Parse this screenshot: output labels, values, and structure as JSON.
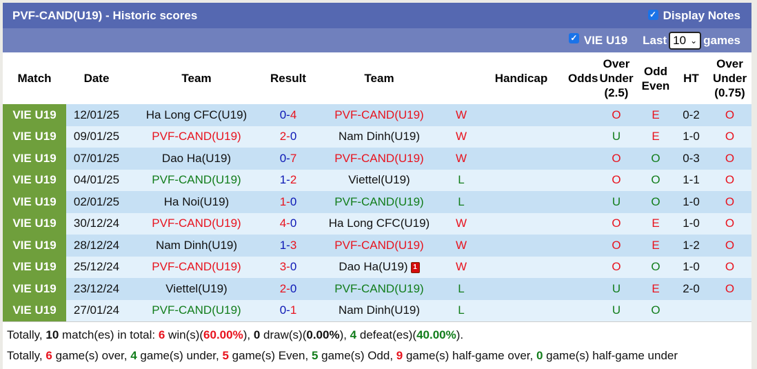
{
  "header": {
    "title": "PVF-CAND(U19) - Historic scores",
    "display_notes_label": "Display Notes",
    "display_notes_checked": true
  },
  "filters": {
    "league_label": "VIE U19",
    "league_checked": true,
    "last_label": "Last",
    "games_count": "10",
    "games_label": "games"
  },
  "columns": [
    "Match",
    "Date",
    "Team",
    "Result",
    "Team",
    "",
    "Handicap",
    "Odds",
    "Over Under (2.5)",
    "Odd Even",
    "HT",
    "Over Under (0.75)"
  ],
  "column_lines": {
    "ou25": [
      "Over",
      "Under",
      "(2.5)"
    ],
    "oddeven": [
      "Odd",
      "Even"
    ],
    "ou075": [
      "Over",
      "Under",
      "(0.75)"
    ]
  },
  "rows": [
    {
      "league": "VIE U19",
      "date": "12/01/25",
      "home": "Ha Long CFC(U19)",
      "home_color": "black",
      "score_home": "0",
      "score_away": "4",
      "away": "PVF-CAND(U19)",
      "away_color": "red",
      "outcome": "W",
      "handicap": "",
      "odds": "",
      "ou": "O",
      "oe": "E",
      "ht": "0-2",
      "ou075": "O"
    },
    {
      "league": "VIE U19",
      "date": "09/01/25",
      "home": "PVF-CAND(U19)",
      "home_color": "red",
      "score_home": "2",
      "score_away": "0",
      "away": "Nam Dinh(U19)",
      "away_color": "black",
      "outcome": "W",
      "handicap": "",
      "odds": "",
      "ou": "U",
      "oe": "E",
      "ht": "1-0",
      "ou075": "O"
    },
    {
      "league": "VIE U19",
      "date": "07/01/25",
      "home": "Dao Ha(U19)",
      "home_color": "black",
      "score_home": "0",
      "score_away": "7",
      "away": "PVF-CAND(U19)",
      "away_color": "red",
      "outcome": "W",
      "handicap": "",
      "odds": "",
      "ou": "O",
      "oe": "O",
      "ht": "0-3",
      "ou075": "O"
    },
    {
      "league": "VIE U19",
      "date": "04/01/25",
      "home": "PVF-CAND(U19)",
      "home_color": "green",
      "score_home": "1",
      "score_away": "2",
      "away": "Viettel(U19)",
      "away_color": "black",
      "outcome": "L",
      "handicap": "",
      "odds": "",
      "ou": "O",
      "oe": "O",
      "ht": "1-1",
      "ou075": "O"
    },
    {
      "league": "VIE U19",
      "date": "02/01/25",
      "home": "Ha Noi(U19)",
      "home_color": "black",
      "score_home": "1",
      "score_away": "0",
      "away": "PVF-CAND(U19)",
      "away_color": "green",
      "outcome": "L",
      "handicap": "",
      "odds": "",
      "ou": "U",
      "oe": "O",
      "ht": "1-0",
      "ou075": "O"
    },
    {
      "league": "VIE U19",
      "date": "30/12/24",
      "home": "PVF-CAND(U19)",
      "home_color": "red",
      "score_home": "4",
      "score_away": "0",
      "away": "Ha Long CFC(U19)",
      "away_color": "black",
      "outcome": "W",
      "handicap": "",
      "odds": "",
      "ou": "O",
      "oe": "E",
      "ht": "1-0",
      "ou075": "O"
    },
    {
      "league": "VIE U19",
      "date": "28/12/24",
      "home": "Nam Dinh(U19)",
      "home_color": "black",
      "score_home": "1",
      "score_away": "3",
      "away": "PVF-CAND(U19)",
      "away_color": "red",
      "outcome": "W",
      "handicap": "",
      "odds": "",
      "ou": "O",
      "oe": "E",
      "ht": "1-2",
      "ou075": "O"
    },
    {
      "league": "VIE U19",
      "date": "25/12/24",
      "home": "PVF-CAND(U19)",
      "home_color": "red",
      "score_home": "3",
      "score_away": "0",
      "away": "Dao Ha(U19)",
      "away_color": "black",
      "away_red_cards": "1",
      "outcome": "W",
      "handicap": "",
      "odds": "",
      "ou": "O",
      "oe": "O",
      "ht": "1-0",
      "ou075": "O"
    },
    {
      "league": "VIE U19",
      "date": "23/12/24",
      "home": "Viettel(U19)",
      "home_color": "black",
      "score_home": "2",
      "score_away": "0",
      "away": "PVF-CAND(U19)",
      "away_color": "green",
      "outcome": "L",
      "handicap": "",
      "odds": "",
      "ou": "U",
      "oe": "E",
      "ht": "2-0",
      "ou075": "O"
    },
    {
      "league": "VIE U19",
      "date": "27/01/24",
      "home": "PVF-CAND(U19)",
      "home_color": "green",
      "score_home": "0",
      "score_away": "1",
      "away": "Nam Dinh(U19)",
      "away_color": "black",
      "outcome": "L",
      "handicap": "",
      "odds": "",
      "ou": "U",
      "oe": "O",
      "ht": "",
      "ou075": ""
    }
  ],
  "summary": {
    "line1": [
      {
        "t": "Totally, ",
        "c": ""
      },
      {
        "t": "10",
        "c": "b"
      },
      {
        "t": " match(es) in total: ",
        "c": ""
      },
      {
        "t": "6",
        "c": "red b"
      },
      {
        "t": " win(s)(",
        "c": ""
      },
      {
        "t": "60.00%",
        "c": "red b"
      },
      {
        "t": "), ",
        "c": ""
      },
      {
        "t": "0",
        "c": "blue b"
      },
      {
        "t": " draw(s)(",
        "c": ""
      },
      {
        "t": "0.00%",
        "c": "blue b"
      },
      {
        "t": "), ",
        "c": ""
      },
      {
        "t": "4",
        "c": "green b"
      },
      {
        "t": " defeat(es)(",
        "c": ""
      },
      {
        "t": "40.00%",
        "c": "green b"
      },
      {
        "t": ").",
        "c": ""
      }
    ],
    "line2": [
      {
        "t": "Totally, ",
        "c": ""
      },
      {
        "t": "6",
        "c": "red b"
      },
      {
        "t": " game(s) over, ",
        "c": ""
      },
      {
        "t": "4",
        "c": "green b"
      },
      {
        "t": " game(s) under, ",
        "c": ""
      },
      {
        "t": "5",
        "c": "red b"
      },
      {
        "t": " game(s) Even, ",
        "c": ""
      },
      {
        "t": "5",
        "c": "green b"
      },
      {
        "t": " game(s) Odd, ",
        "c": ""
      },
      {
        "t": "9",
        "c": "red b"
      },
      {
        "t": " game(s) half-game over, ",
        "c": ""
      },
      {
        "t": "0",
        "c": "green b"
      },
      {
        "t": " game(s) half-game under",
        "c": ""
      }
    ]
  },
  "colors": {
    "title_bg": "#5568b1",
    "filter_bg": "#7080bd",
    "league_bg": "#6f9f3c",
    "row_odd": "#c6e0f4",
    "row_even": "#e3f1fb",
    "win": "#e8131e",
    "loss": "#127d1b",
    "score_low": "#0d18b5"
  }
}
